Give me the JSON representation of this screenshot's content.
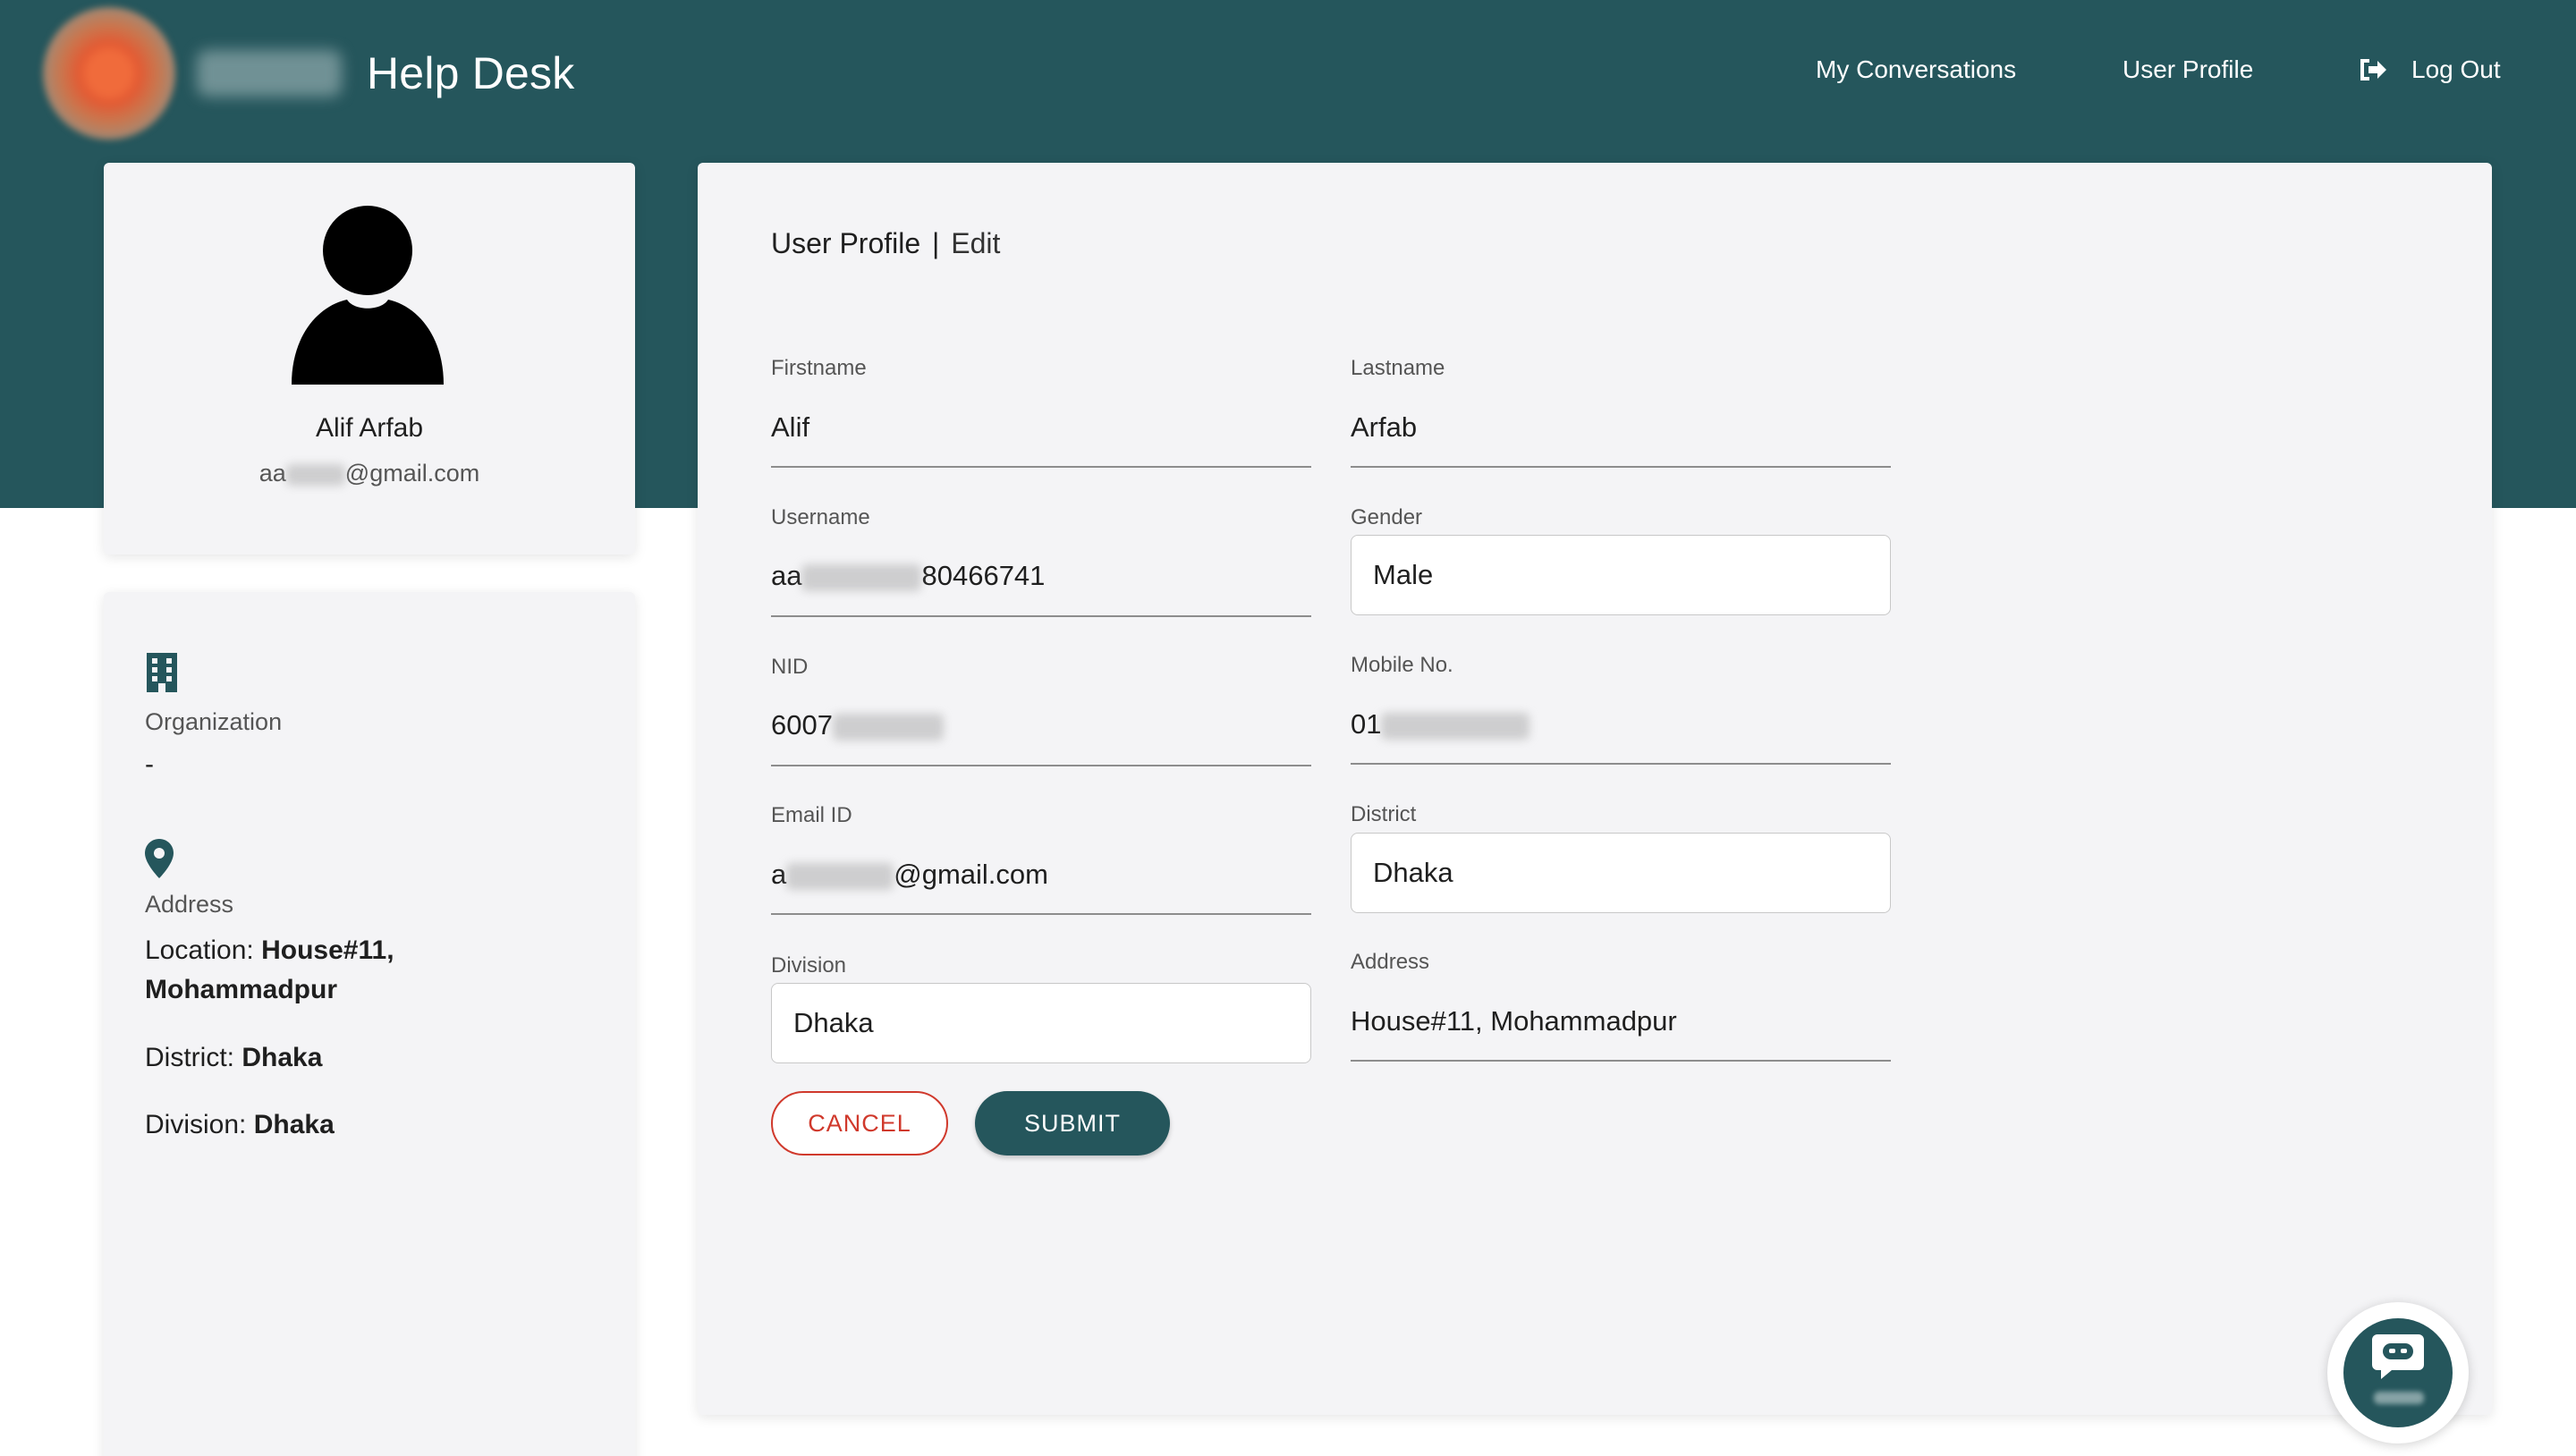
{
  "header": {
    "title": "Help Desk",
    "nav": {
      "my_conversations": "My Conversations",
      "user_profile": "User Profile",
      "log_out": "Log Out"
    }
  },
  "profile_card": {
    "name": "Alif Arfab",
    "email_prefix": "aa",
    "email_suffix": "@gmail.com"
  },
  "info_card": {
    "organization_label": "Organization",
    "organization_value": "-",
    "address_label": "Address",
    "location_key": "Location:",
    "location_value_line1": "House#11,",
    "location_value_line2": "Mohammadpur",
    "district_key": "District:",
    "district_value": "Dhaka",
    "division_key": "Division:",
    "division_value": "Dhaka"
  },
  "form": {
    "title": "User Profile",
    "title_separator": "|",
    "title_mode": "Edit",
    "firstname": {
      "label": "Firstname",
      "value": "Alif"
    },
    "lastname": {
      "label": "Lastname",
      "value": "Arfab"
    },
    "username": {
      "label": "Username",
      "value_prefix": "aa",
      "value_suffix": "80466741"
    },
    "gender": {
      "label": "Gender",
      "value": "Male"
    },
    "nid": {
      "label": "NID",
      "value_prefix": "6007"
    },
    "mobile": {
      "label": "Mobile No.",
      "value_prefix": "01"
    },
    "email": {
      "label": "Email ID",
      "value_prefix": "a",
      "value_suffix": "@gmail.com"
    },
    "district": {
      "label": "District",
      "value": "Dhaka"
    },
    "division": {
      "label": "Division",
      "value": "Dhaka"
    },
    "address": {
      "label": "Address",
      "value": "House#11, Mohammadpur"
    },
    "cancel_label": "CANCEL",
    "submit_label": "SUBMIT"
  },
  "colors": {
    "primary": "#25565c",
    "cancel": "#d0392c",
    "card_bg": "#f4f4f6"
  },
  "icons": [
    "logout-icon",
    "avatar-icon",
    "building-icon",
    "location-pin-icon",
    "chat-bot-icon"
  ]
}
